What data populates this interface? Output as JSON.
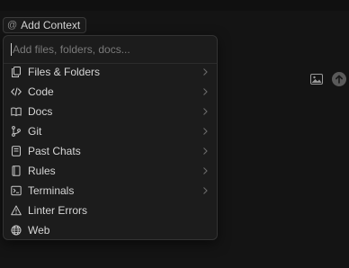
{
  "add_context": {
    "icon": "at-sign-icon",
    "label": "Add Context"
  },
  "search": {
    "placeholder": "Add files, folders, docs...",
    "value": ""
  },
  "menu": {
    "items": [
      {
        "label": "Files & Folders",
        "icon": "files-icon",
        "submenu": true
      },
      {
        "label": "Code",
        "icon": "code-icon",
        "submenu": true
      },
      {
        "label": "Docs",
        "icon": "book-icon",
        "submenu": true
      },
      {
        "label": "Git",
        "icon": "git-branch-icon",
        "submenu": true
      },
      {
        "label": "Past Chats",
        "icon": "chat-history-icon",
        "submenu": true
      },
      {
        "label": "Rules",
        "icon": "rules-file-icon",
        "submenu": true
      },
      {
        "label": "Terminals",
        "icon": "terminal-icon",
        "submenu": true
      },
      {
        "label": "Linter Errors",
        "icon": "warning-triangle-icon",
        "submenu": false
      },
      {
        "label": "Web",
        "icon": "globe-icon",
        "submenu": false
      }
    ]
  },
  "toolbar": {
    "image_icon": "image-icon",
    "send_icon": "arrow-up-icon"
  },
  "colors": {
    "background": "#141414",
    "menu_background": "#1c1c1c",
    "text": "#d6d6d6",
    "muted_text": "#7a7a7a",
    "border": "#333333"
  }
}
